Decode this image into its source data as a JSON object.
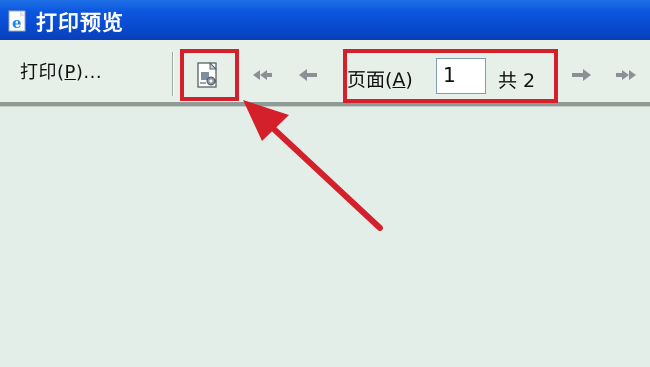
{
  "window": {
    "title": "打印预览"
  },
  "toolbar": {
    "print_label_prefix": "打印(",
    "print_label_key": "P",
    "print_label_suffix": ")...",
    "page_label_prefix": "页面(",
    "page_label_key": "A",
    "page_label_suffix": ")",
    "current_page": "1",
    "total_label": "共 2"
  },
  "icons": {
    "app": "ie-document-icon",
    "page_setup": "page-setup-icon",
    "first_page": "first-page-icon",
    "prev_page": "previous-page-icon",
    "next_page": "next-page-icon",
    "last_page": "last-page-icon"
  },
  "colors": {
    "title_bar": "#0b56de",
    "highlight": "#d3202a",
    "toolbar_bg": "#e7efe9",
    "canvas_bg": "#e4eee9"
  }
}
